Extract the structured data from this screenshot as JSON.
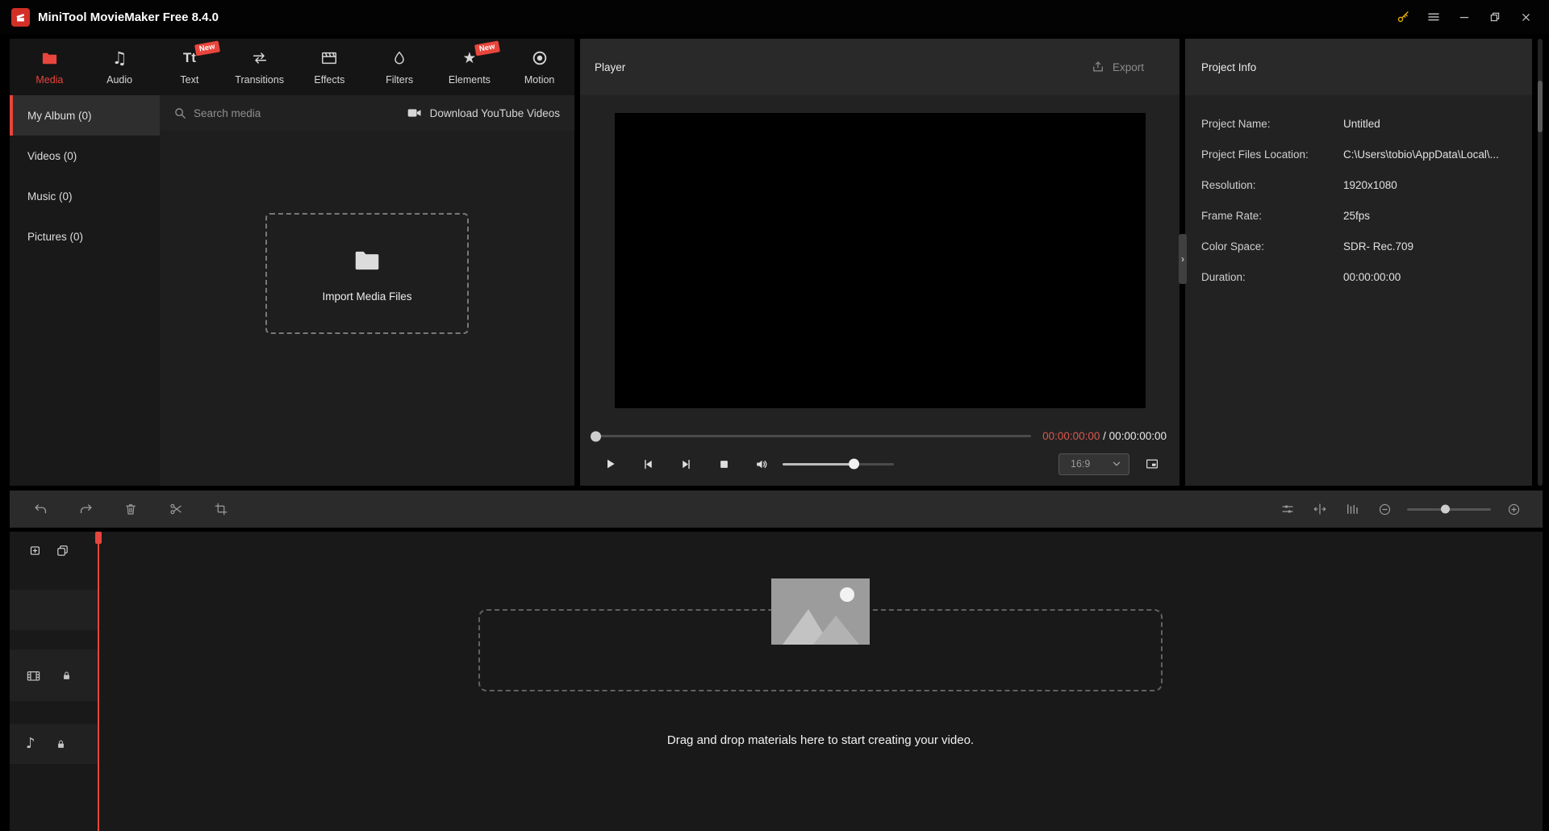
{
  "titlebar": {
    "app_title": "MiniTool MovieMaker Free 8.4.0"
  },
  "ribbon_tabs": [
    {
      "label": "Media",
      "icon": "folder-icon",
      "active": true
    },
    {
      "label": "Audio",
      "icon": "music-notes-icon",
      "active": false
    },
    {
      "label": "Text",
      "icon": "text-icon",
      "badge": "New",
      "active": false
    },
    {
      "label": "Transitions",
      "icon": "transitions-icon",
      "active": false
    },
    {
      "label": "Effects",
      "icon": "clapperboard-icon",
      "active": false
    },
    {
      "label": "Filters",
      "icon": "droplet-icon",
      "active": false
    },
    {
      "label": "Elements",
      "icon": "star-icon",
      "badge": "New",
      "active": false
    },
    {
      "label": "Motion",
      "icon": "motion-icon",
      "active": false
    }
  ],
  "album_sidebar": {
    "items": [
      {
        "label": "My Album (0)",
        "active": true
      },
      {
        "label": "Videos (0)",
        "active": false
      },
      {
        "label": "Music (0)",
        "active": false
      },
      {
        "label": "Pictures (0)",
        "active": false
      }
    ]
  },
  "media_toolbar": {
    "search_placeholder": "Search media",
    "download_youtube_label": "Download YouTube Videos"
  },
  "import_box": {
    "label": "Import Media Files"
  },
  "player": {
    "title": "Player",
    "export_label": "Export",
    "current_time": "00:00:00:00",
    "time_separator": " / ",
    "total_time": "00:00:00:00",
    "aspect_ratio": "16:9"
  },
  "project_info": {
    "title": "Project Info",
    "fields": [
      {
        "label": "Project Name:",
        "value": "Untitled"
      },
      {
        "label": "Project Files Location:",
        "value": "C:\\Users\\tobio\\AppData\\Local\\..."
      },
      {
        "label": "Resolution:",
        "value": "1920x1080"
      },
      {
        "label": "Frame Rate:",
        "value": "25fps"
      },
      {
        "label": "Color Space:",
        "value": "SDR- Rec.709"
      },
      {
        "label": "Duration:",
        "value": "00:00:00:00"
      }
    ]
  },
  "timeline": {
    "dropzone_text": "Drag and drop materials here to start creating your video."
  },
  "glyphs": {
    "audio_note": "♫",
    "text_tab": "Tt",
    "elements_star": "★",
    "audio_track_note": "♪",
    "collapse_chevron": "›"
  },
  "colors": {
    "accent": "#e8453c",
    "key_icon": "#e7b10a",
    "current_time": "#d95750",
    "panel_bg": "#222222",
    "timeline_bg": "#191919"
  }
}
